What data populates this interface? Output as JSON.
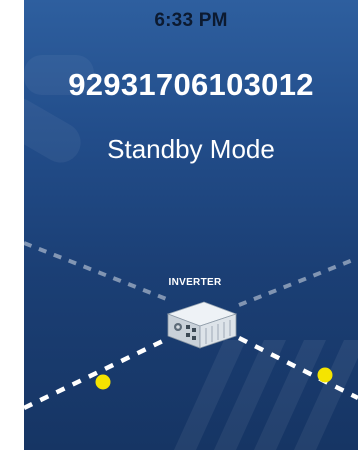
{
  "status_bar": {
    "time": "6:33 PM"
  },
  "device": {
    "serial": "92931706103012",
    "mode": "Standby Mode"
  },
  "diagram": {
    "inverter_label": "INVERTER",
    "flow_dot_color": "#f5e400",
    "line_color": "#ffffff",
    "icons": [
      "inverter-icon"
    ]
  },
  "colors": {
    "background_top": "#2e5f9f",
    "background_bottom": "#163564",
    "text": "#ffffff"
  }
}
